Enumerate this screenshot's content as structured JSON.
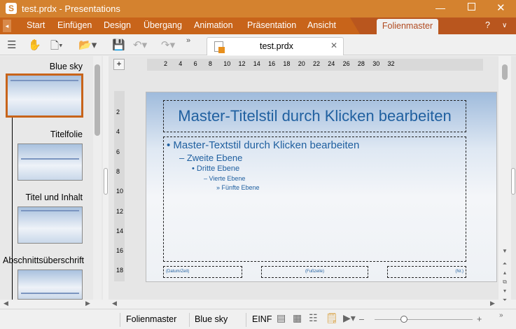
{
  "window": {
    "title": "test.prdx - Presentations",
    "app_icon_letter": "S"
  },
  "menu": {
    "items": [
      "Start",
      "Einfügen",
      "Design",
      "Übergang",
      "Animation",
      "Präsentation",
      "Ansicht"
    ],
    "active_tab": "Folienmaster",
    "help": "?"
  },
  "document_tab": {
    "label": "test.prdx"
  },
  "sidebar": {
    "items": [
      {
        "label": "Blue sky",
        "selected": true
      },
      {
        "label": "Titelfolie"
      },
      {
        "label": "Titel und Inhalt"
      },
      {
        "label": "Abschnittsüberschrift"
      }
    ]
  },
  "ruler": {
    "horizontal": [
      "2",
      "4",
      "6",
      "8",
      "10",
      "12",
      "14",
      "16",
      "18",
      "20",
      "22",
      "24",
      "26",
      "28",
      "30",
      "32"
    ],
    "vertical": [
      "2",
      "4",
      "6",
      "8",
      "10",
      "12",
      "14",
      "16",
      "18"
    ]
  },
  "slide": {
    "title": "Master-Titelstil durch Klicken bearbeiten",
    "levels": [
      "Master-Textstil durch Klicken bearbeiten",
      "Zweite Ebene",
      "Dritte Ebene",
      "Vierte Ebene",
      "Fünfte Ebene"
    ],
    "footer_date": "(Datum/Zeit)",
    "footer_text": "(Fußzeile)",
    "footer_num": "(Nr.)"
  },
  "status": {
    "mode": "Folienmaster",
    "master": "Blue sky",
    "insert": "EINF",
    "zoom_percent": 30
  },
  "colors": {
    "accent": "#c8641a",
    "title_bar": "#d4822f",
    "text_blue": "#2060a0"
  }
}
